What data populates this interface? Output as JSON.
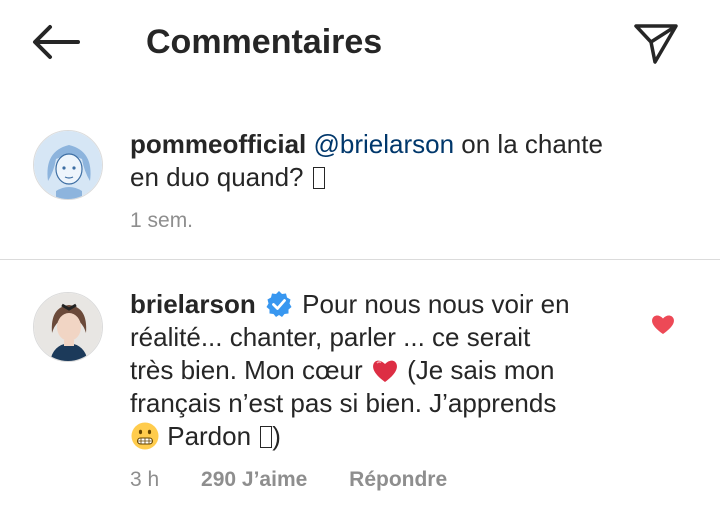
{
  "header": {
    "title": "Commentaires"
  },
  "comments": [
    {
      "username": "pommeofficial",
      "mention": "@brielarson",
      "text_line1": " on la chante",
      "text_line2": "en duo quand? ",
      "time": "1 sem."
    },
    {
      "username": "brielarson",
      "verified": true,
      "text_line1": " Pour nous nous voir en",
      "text_line2": "réalité... chanter, parler ... ce serait",
      "text_line3_a": "très bien. Mon cœur ",
      "text_line3_b": " (Je sais mon",
      "text_line4": "français n’est pas si bien. J’apprends",
      "text_line5": " Pardon ",
      "text_line5_end": ")",
      "time": "3 h",
      "likes": "290 J’aime",
      "reply_label": "Répondre",
      "liked": true
    }
  ],
  "colors": {
    "text": "#262626",
    "mention": "#00376b",
    "meta": "#8e8e8e",
    "heart": "#ed4956",
    "verified": "#3897f0"
  },
  "icons": [
    "back-arrow-icon",
    "send-icon",
    "verified-icon",
    "heart-icon",
    "red-heart-emoji",
    "grimacing-face-emoji"
  ]
}
